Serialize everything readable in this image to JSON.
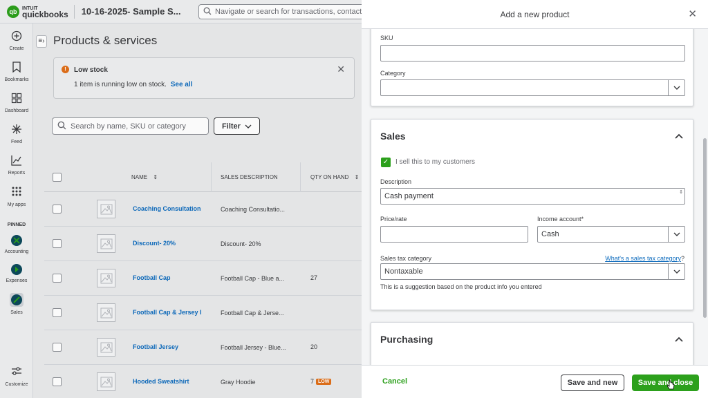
{
  "topbar": {
    "logo_intuit": "INTUIT",
    "logo_product": "quickbooks",
    "company_name": "10-16-2025- Sample S...",
    "search_placeholder": "Navigate or search for transactions, contacts, reports"
  },
  "rail": {
    "items": [
      {
        "label": "Create",
        "icon": "plus-circle-icon"
      },
      {
        "label": "Bookmarks",
        "icon": "bookmark-icon"
      },
      {
        "label": "Dashboard",
        "icon": "dashboard-icon"
      },
      {
        "label": "Feed",
        "icon": "feed-icon"
      },
      {
        "label": "Reports",
        "icon": "reports-icon"
      },
      {
        "label": "My apps",
        "icon": "apps-icon"
      }
    ],
    "pinned_label": "PINNED",
    "pinned": [
      {
        "label": "Accounting",
        "color": "#0d4a5c"
      },
      {
        "label": "Expenses",
        "color": "#0d4a5c"
      },
      {
        "label": "Sales",
        "color": "#0d4a5c"
      }
    ],
    "customize_label": "Customize"
  },
  "main": {
    "title": "Products & services",
    "alert": {
      "title": "Low stock",
      "message": "1 item is running low on stock.",
      "link": "See all"
    },
    "search_placeholder": "Search by name, SKU or category",
    "filter_label": "Filter",
    "columns": {
      "name": "NAME",
      "sales_description": "SALES DESCRIPTION",
      "qty": "QTY ON HAND"
    },
    "rows": [
      {
        "name": "Coaching Consultation",
        "desc": "Coaching Consultatio...",
        "qty": ""
      },
      {
        "name": "Discount- 20%",
        "desc": "Discount- 20%",
        "qty": ""
      },
      {
        "name": "Football Cap",
        "desc": "Football Cap - Blue a...",
        "qty": "27"
      },
      {
        "name": "Football Cap & Jersey I",
        "desc": "Football Cap & Jerse...",
        "qty": ""
      },
      {
        "name": "Football Jersey",
        "desc": "Football Jersey - Blue...",
        "qty": "20"
      },
      {
        "name": "Hooded Sweatshirt",
        "desc": "Gray Hoodie",
        "qty": "7",
        "badge": "LOW"
      }
    ]
  },
  "drawer": {
    "title": "Add a new product",
    "sku_label": "SKU",
    "sku_value": "",
    "category_label": "Category",
    "category_value": "",
    "sales": {
      "title": "Sales",
      "sell_checkbox_label": "I sell this to my customers",
      "sell_checked": true,
      "description_label": "Description",
      "description_value": "Cash payment",
      "price_label": "Price/rate",
      "price_value": "",
      "income_label": "Income account*",
      "income_value": "Cash",
      "tax_label": "Sales tax category",
      "tax_link": "What's a sales tax category",
      "tax_link_suffix": "?",
      "tax_value": "Nontaxable",
      "tax_hint": "This is a suggestion based on the product info you entered"
    },
    "purchasing": {
      "title": "Purchasing"
    },
    "footer": {
      "cancel": "Cancel",
      "save_new": "Save and new",
      "save_close": "Save and close"
    }
  },
  "colors": {
    "brand_green": "#2ca01c",
    "link_blue": "#0d6bbd",
    "warning_orange": "#e0701a"
  }
}
